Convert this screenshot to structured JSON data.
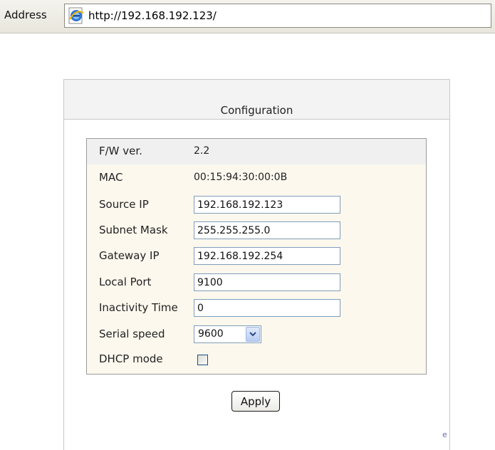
{
  "browser": {
    "address_label": "Address",
    "url": "http://192.168.192.123/"
  },
  "config": {
    "title": "Configuration",
    "fw": {
      "label": "F/W ver.",
      "value": "2.2"
    },
    "mac": {
      "label": "MAC",
      "value": "00:15:94:30:00:0B"
    },
    "source_ip": {
      "label": "Source IP",
      "value": "192.168.192.123"
    },
    "subnet_mask": {
      "label": "Subnet Mask",
      "value": "255.255.255.0"
    },
    "gateway_ip": {
      "label": "Gateway IP",
      "value": "192.168.192.254"
    },
    "local_port": {
      "label": "Local Port",
      "value": "9100"
    },
    "inactivity_time": {
      "label": "Inactivity Time",
      "value": "0"
    },
    "serial_speed": {
      "label": "Serial speed",
      "value": "9600"
    },
    "dhcp_mode": {
      "label": "DHCP mode",
      "checked": false
    },
    "apply_label": "Apply"
  },
  "footer": {
    "stray_char": "e"
  },
  "colors": {
    "form_background": "#fcf8ee",
    "header_background": "#f3f3f3",
    "input_border": "#7f9db9"
  },
  "icons": {
    "address_icon": "ie-page-icon",
    "select_arrow": "chevron-down-icon"
  }
}
